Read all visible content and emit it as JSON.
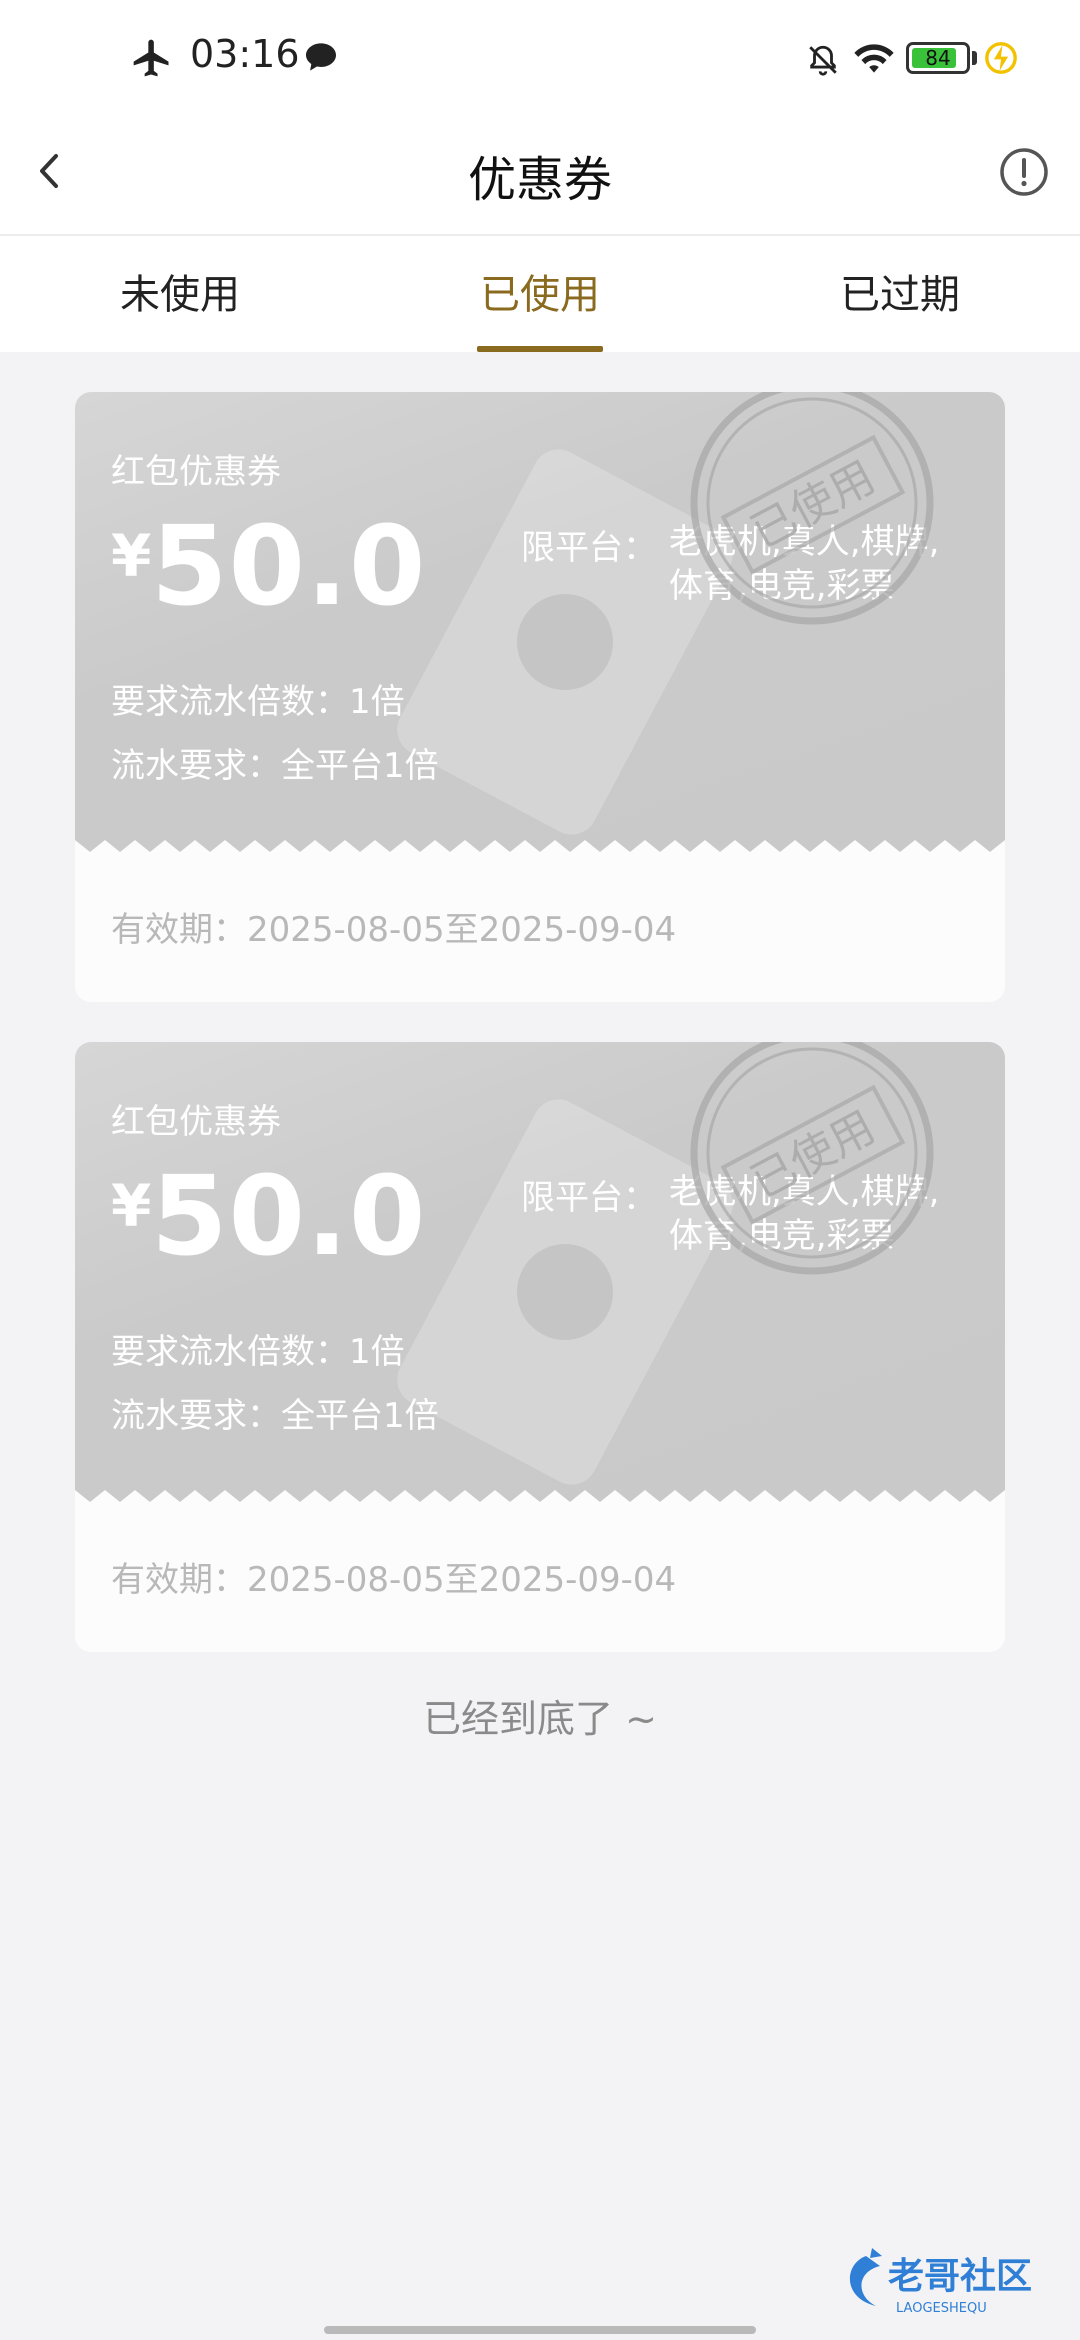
{
  "status_bar": {
    "time": "03:16",
    "battery_level": "84",
    "battery_fraction": 0.84,
    "icons": [
      "airplane-icon",
      "message-icon",
      "bell-off-icon",
      "wifi-icon",
      "battery-icon",
      "charging-icon"
    ]
  },
  "header": {
    "title": "优惠券",
    "back_icon": "chevron-left-icon",
    "info_icon": "info-circle-icon"
  },
  "tabs": [
    {
      "label": "未使用",
      "active": false
    },
    {
      "label": "已使用",
      "active": true
    },
    {
      "label": "已过期",
      "active": false
    }
  ],
  "colors": {
    "accent": "#8a6a1f",
    "card_top": "#cccccc",
    "page_bg": "#f3f3f5"
  },
  "coupons": [
    {
      "type": "红包优惠券",
      "currency": "¥",
      "amount": "50.0",
      "platform_label": "限平台：",
      "platform_value": "老虎机,真人,棋牌,体育,电竞,彩票",
      "multiple": "要求流水倍数：1倍",
      "turnover": "流水要求：全平台1倍",
      "validity": "有效期：2025-08-05至2025-09-04",
      "stamp": "已使用"
    },
    {
      "type": "红包优惠券",
      "currency": "¥",
      "amount": "50.0",
      "platform_label": "限平台：",
      "platform_value": "老虎机,真人,棋牌,体育,电竞,彩票",
      "multiple": "要求流水倍数：1倍",
      "turnover": "流水要求：全平台1倍",
      "validity": "有效期：2025-08-05至2025-09-04",
      "stamp": "已使用"
    }
  ],
  "end_text": "已经到底了 ~",
  "watermark": {
    "title": "老哥社区",
    "subtitle": "LAOGESHEQU"
  }
}
